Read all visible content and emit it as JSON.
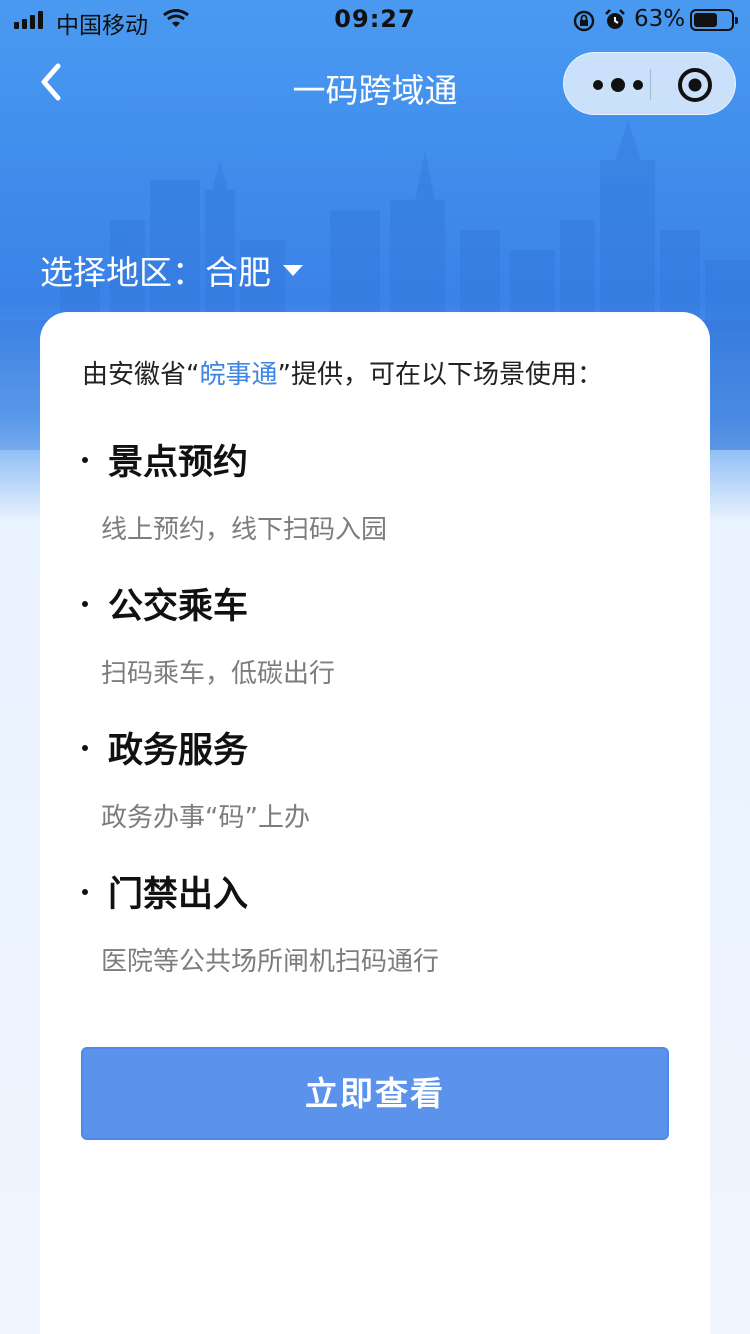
{
  "status_bar": {
    "carrier": "中国移动",
    "time": "09:27",
    "battery_percent": "63%",
    "battery_level": 0.63
  },
  "nav": {
    "title": "一码跨域通",
    "back_icon": "chevron-left-icon",
    "more_icon": "more-dots-icon",
    "close_icon": "target-close-icon"
  },
  "region": {
    "label": "选择地区：",
    "value": "合肥"
  },
  "intro": {
    "prefix": "由安徽省“",
    "highlight": "皖事通",
    "suffix": "”提供，可在以下场景使用："
  },
  "scenes": [
    {
      "title": "景点预约",
      "desc": "线上预约，线下扫码入园"
    },
    {
      "title": "公交乘车",
      "desc": "扫码乘车，低碳出行"
    },
    {
      "title": "政务服务",
      "desc": "政务办事“码”上办"
    },
    {
      "title": "门禁出入",
      "desc": "医院等公共场所闸机扫码通行"
    }
  ],
  "primary_button": {
    "label": "立即查看"
  },
  "colors": {
    "header_blue": "#3f8cec",
    "highlight_blue": "#3d86e4",
    "button_blue": "#5b92ec",
    "desc_gray": "#7d7d7d"
  }
}
